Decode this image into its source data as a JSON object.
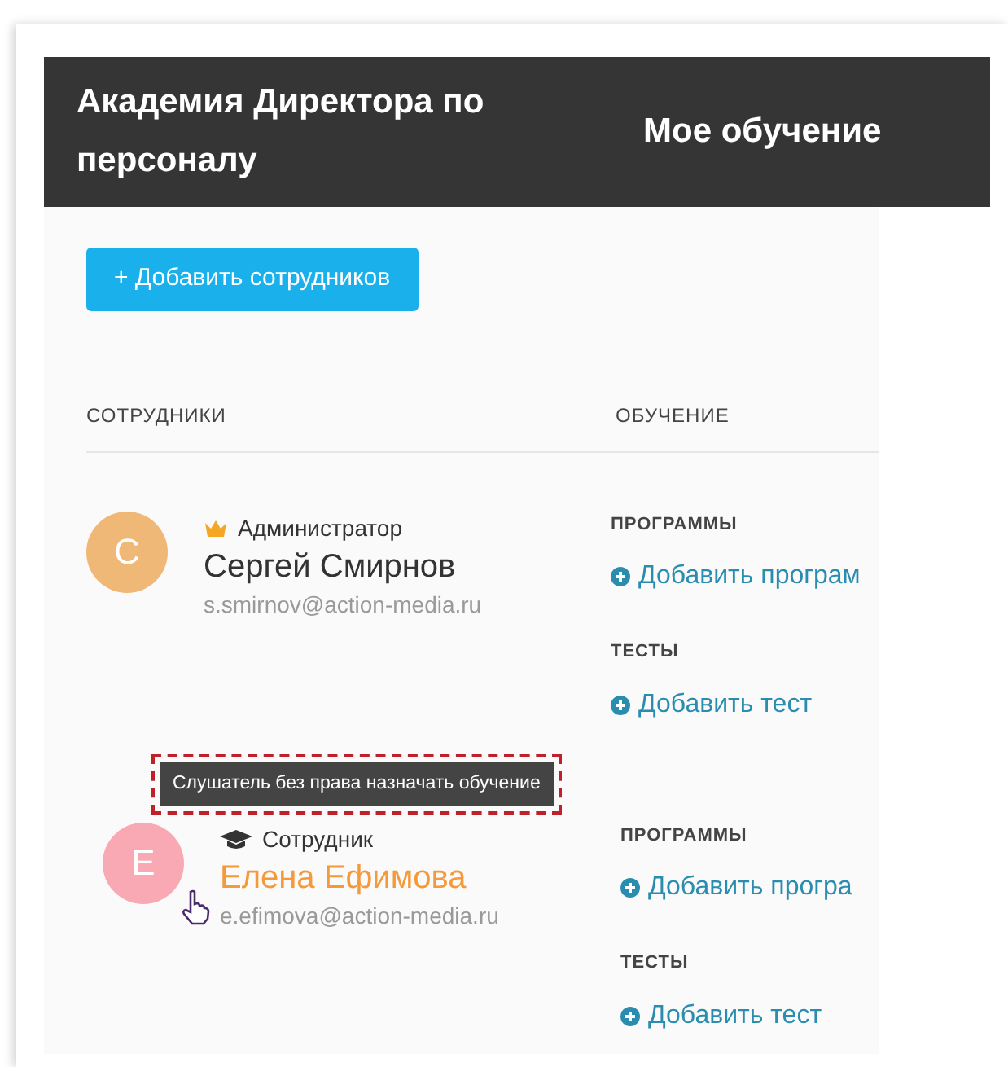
{
  "header": {
    "title": "Академия Директора по персоналу",
    "nav": "Мое обучение"
  },
  "add_button": "+ Добавить сотрудников",
  "columns": [
    "СОТРУДНИКИ",
    "ОБУЧЕНИЕ"
  ],
  "employees": [
    {
      "initial": "С",
      "color": "#f0b877",
      "role": "Администратор",
      "kind": "admin",
      "name": "Сергей Смирнов",
      "hovered": false,
      "email": "s.smirnov@action-media.ru",
      "sections": [
        {
          "heading": "ПРОГРАММЫ",
          "link": "Добавить програм"
        },
        {
          "heading": "ТЕСТЫ",
          "link": "Добавить тест"
        }
      ]
    },
    {
      "initial": "Е",
      "color": "#f9a9b4",
      "role": "Сотрудник",
      "kind": "employee",
      "name": "Елена Ефимова",
      "hovered": true,
      "tooltip": "Слушатель без права назначать обучение",
      "email": "e.efimova@action-media.ru",
      "sections": [
        {
          "heading": "ПРОГРАММЫ",
          "link": "Добавить програ"
        },
        {
          "heading": "ТЕСТЫ",
          "link": "Добавить тест"
        }
      ]
    }
  ]
}
